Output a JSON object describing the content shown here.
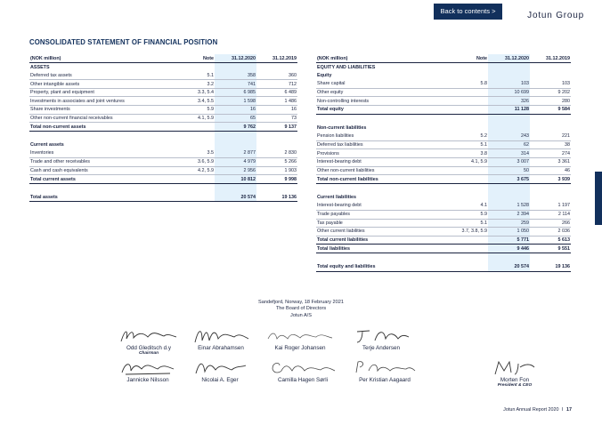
{
  "header": {
    "back_label": "Back to contents >",
    "brand": "Jotun Group"
  },
  "title": "CONSOLIDATED STATEMENT OF FINANCIAL POSITION",
  "left_table": {
    "headers": [
      "(NOK million)",
      "Note",
      "31.12.2020",
      "31.12.2019"
    ],
    "rows": [
      {
        "type": "sec",
        "label": "ASSETS",
        "note": "",
        "v2020": "",
        "v2019": ""
      },
      {
        "type": "item",
        "label": "Deferred tax assets",
        "note": "5.1",
        "v2020": "358",
        "v2019": "360"
      },
      {
        "type": "item",
        "label": "Other intangible assets",
        "note": "3.2",
        "v2020": "741",
        "v2019": "712"
      },
      {
        "type": "item",
        "label": "Property, plant and equipment",
        "note": "3.3, 5.4",
        "v2020": "6 985",
        "v2019": "6 489"
      },
      {
        "type": "item",
        "label": "Investments in associates and joint ventures",
        "note": "3.4, 5.5",
        "v2020": "1 598",
        "v2019": "1 486"
      },
      {
        "type": "item",
        "label": "Share investments",
        "note": "5.9",
        "v2020": "16",
        "v2019": "16"
      },
      {
        "type": "item",
        "label": "Other non-current financial receivables",
        "note": "4.1, 5.9",
        "v2020": "65",
        "v2019": "73"
      },
      {
        "type": "total",
        "label": "Total non-current assets",
        "note": "",
        "v2020": "9 762",
        "v2019": "9 137"
      },
      {
        "type": "gap",
        "label": "",
        "note": "",
        "v2020": "",
        "v2019": ""
      },
      {
        "type": "sub",
        "label": "Current assets",
        "note": "",
        "v2020": "",
        "v2019": ""
      },
      {
        "type": "item",
        "label": "Inventories",
        "note": "3.5",
        "v2020": "2 877",
        "v2019": "2 830"
      },
      {
        "type": "item",
        "label": "Trade and other receivables",
        "note": "3.6, 5.9",
        "v2020": "4 979",
        "v2019": "5 266"
      },
      {
        "type": "item",
        "label": "Cash and cash equivalents",
        "note": "4.2, 5.9",
        "v2020": "2 956",
        "v2019": "1 903"
      },
      {
        "type": "total",
        "label": "Total current assets",
        "note": "",
        "v2020": "10 812",
        "v2019": "9 998"
      },
      {
        "type": "gap",
        "label": "",
        "note": "",
        "v2020": "",
        "v2019": ""
      },
      {
        "type": "total",
        "label": "Total assets",
        "note": "",
        "v2020": "20 574",
        "v2019": "19 136"
      }
    ]
  },
  "right_table": {
    "headers": [
      "(NOK million)",
      "Note",
      "31.12.2020",
      "31.12.2019"
    ],
    "rows": [
      {
        "type": "sec",
        "label": "EQUITY AND LIABILITIES",
        "note": "",
        "v2020": "",
        "v2019": ""
      },
      {
        "type": "sub",
        "label": "Equity",
        "note": "",
        "v2020": "",
        "v2019": ""
      },
      {
        "type": "item",
        "label": "Share capital",
        "note": "5.8",
        "v2020": "103",
        "v2019": "103"
      },
      {
        "type": "item",
        "label": "Other equity",
        "note": "",
        "v2020": "10 699",
        "v2019": "9 202"
      },
      {
        "type": "item",
        "label": "Non-controlling interests",
        "note": "",
        "v2020": "326",
        "v2019": "280"
      },
      {
        "type": "total",
        "label": "Total equity",
        "note": "",
        "v2020": "11 128",
        "v2019": "9 584"
      },
      {
        "type": "gap",
        "label": "",
        "note": "",
        "v2020": "",
        "v2019": ""
      },
      {
        "type": "sub",
        "label": "Non-current liabilities",
        "note": "",
        "v2020": "",
        "v2019": ""
      },
      {
        "type": "item",
        "label": "Pension liabilities",
        "note": "5.2",
        "v2020": "243",
        "v2019": "221"
      },
      {
        "type": "item",
        "label": "Deferred tax liabilities",
        "note": "5.1",
        "v2020": "62",
        "v2019": "38"
      },
      {
        "type": "item",
        "label": "Provisions",
        "note": "3.8",
        "v2020": "314",
        "v2019": "274"
      },
      {
        "type": "item",
        "label": "Interest-bearing debt",
        "note": "4.1, 5.9",
        "v2020": "3 007",
        "v2019": "3 361"
      },
      {
        "type": "item",
        "label": "Other non-current liabilities",
        "note": "",
        "v2020": "50",
        "v2019": "46"
      },
      {
        "type": "total",
        "label": "Total non-current liabilities",
        "note": "",
        "v2020": "3 675",
        "v2019": "3 939"
      },
      {
        "type": "gap",
        "label": "",
        "note": "",
        "v2020": "",
        "v2019": ""
      },
      {
        "type": "sub",
        "label": "Current liabilities",
        "note": "",
        "v2020": "",
        "v2019": ""
      },
      {
        "type": "item",
        "label": "Interest-bearing debt",
        "note": "4.1",
        "v2020": "1 528",
        "v2019": "1 197"
      },
      {
        "type": "item",
        "label": "Trade payables",
        "note": "5.9",
        "v2020": "2 394",
        "v2019": "2 114"
      },
      {
        "type": "item",
        "label": "Tax payable",
        "note": "5.1",
        "v2020": "259",
        "v2019": "266"
      },
      {
        "type": "item",
        "label": "Other current liabilities",
        "note": "3.7, 3.8, 5.9",
        "v2020": "1 050",
        "v2019": "2 036"
      },
      {
        "type": "total",
        "label": "Total current liabilities",
        "note": "",
        "v2020": "5 771",
        "v2019": "5 613"
      },
      {
        "type": "total",
        "label": "Total liabilities",
        "note": "",
        "v2020": "9 446",
        "v2019": "9 551"
      },
      {
        "type": "gap",
        "label": "",
        "note": "",
        "v2020": "",
        "v2019": ""
      },
      {
        "type": "total",
        "label": "Total equity and liabilities",
        "note": "",
        "v2020": "20 574",
        "v2019": "19 136"
      }
    ]
  },
  "place_date": [
    "Sandefjord, Norway, 18 February 2021",
    "The Board of Directors",
    "Jotun A/S"
  ],
  "signatures": [
    {
      "name": "Odd Gleditsch d.y",
      "role": "Chairman"
    },
    {
      "name": "Einar Abrahamsen",
      "role": ""
    },
    {
      "name": "Kai Roger Johansen",
      "role": ""
    },
    {
      "name": "Terje Andersen",
      "role": ""
    },
    {
      "name": "Jannicke Nilsson",
      "role": ""
    },
    {
      "name": "Nicolai A. Eger",
      "role": ""
    },
    {
      "name": "Camilla Hagen Sørli",
      "role": ""
    },
    {
      "name": "Per Kristian Aagaard",
      "role": ""
    },
    {
      "name": "Morten Fon",
      "role": "President & CEO"
    }
  ],
  "footer": {
    "text": "Jotun Annual Report 2020",
    "sep": "I",
    "page": "17"
  },
  "colors": {
    "navy": "#12305c",
    "highlight": "#e3f1fb"
  }
}
